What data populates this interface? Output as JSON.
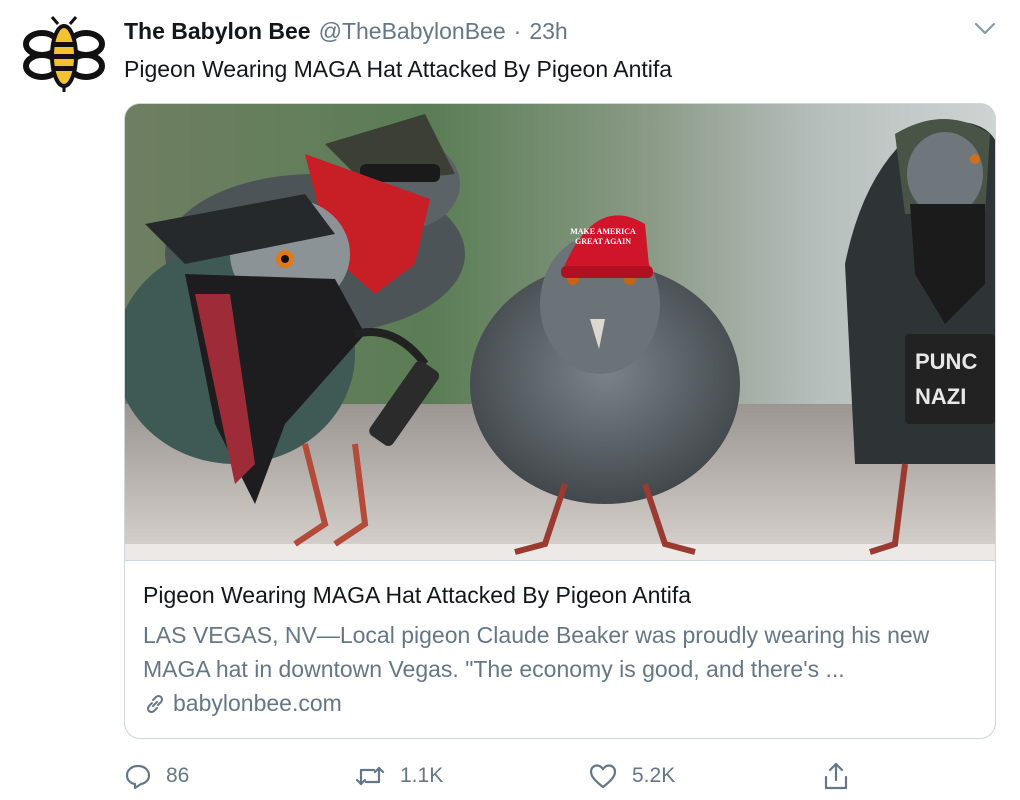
{
  "tweet": {
    "display_name": "The Babylon Bee",
    "handle": "@TheBabylonBee",
    "separator": "·",
    "time": "23h",
    "text": "Pigeon Wearing MAGA Hat Attacked By Pigeon Antifa"
  },
  "card": {
    "image_icon": "pigeons-photo",
    "hat_text_line1": "MAKE AMERICA",
    "hat_text_line2": "GREAT AGAIN",
    "patch_line1": "PUNC",
    "patch_line2": "NAZI",
    "title": "Pigeon Wearing MAGA Hat Attacked By Pigeon Antifa",
    "description": "LAS VEGAS, NV—Local pigeon Claude Beaker was proudly wearing his new MAGA hat in downtown Vegas. \"The economy is good, and there's ...",
    "domain": "babylonbee.com"
  },
  "actions": {
    "reply_count": "86",
    "retweet_count": "1.1K",
    "like_count": "5.2K"
  },
  "icons": {
    "avatar": "babylon-bee-logo",
    "caret": "chevron-down-icon",
    "link": "link-icon",
    "reply": "reply-icon",
    "retweet": "retweet-icon",
    "like": "heart-icon",
    "share": "share-icon"
  },
  "colors": {
    "bee_yellow": "#f2c230",
    "bee_black": "#111111",
    "hat_red": "#d0142a",
    "secondary_text": "#657786",
    "border": "#ccd6dd"
  }
}
